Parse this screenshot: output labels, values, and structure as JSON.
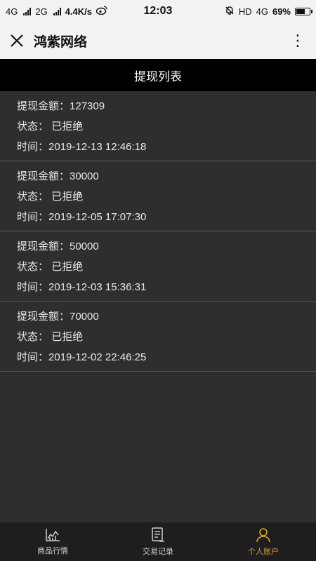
{
  "status_bar": {
    "network1": "4G",
    "network2": "2G",
    "speed": "4.4K/s",
    "time": "12:03",
    "hd": "HD",
    "network3": "4G",
    "battery": "69%",
    "battery_level": 0.69,
    "icons": [
      "signal-icon",
      "weibo-icon",
      "alarm-off-icon",
      "battery-icon"
    ]
  },
  "navbar": {
    "title": "鸿紫网络",
    "more": "⋮"
  },
  "page": {
    "title": "提现列表"
  },
  "labels": {
    "amount": "提现金额：",
    "status": "状态：",
    "time": "时间："
  },
  "withdrawals": [
    {
      "amount": "127309",
      "status": "已拒绝",
      "time": "2019-12-13 12:46:18"
    },
    {
      "amount": "30000",
      "status": "已拒绝",
      "time": "2019-12-05 17:07:30"
    },
    {
      "amount": "50000",
      "status": "已拒绝",
      "time": "2019-12-03 15:36:31"
    },
    {
      "amount": "70000",
      "status": "已拒绝",
      "time": "2019-12-02 22:46:25"
    }
  ],
  "tabbar": {
    "tabs": [
      {
        "label": "商品行情",
        "icon": "chart-icon"
      },
      {
        "label": "交易记录",
        "icon": "document-icon"
      },
      {
        "label": "个人账户",
        "icon": "user-icon"
      }
    ],
    "active_color": "#d9a23a"
  }
}
